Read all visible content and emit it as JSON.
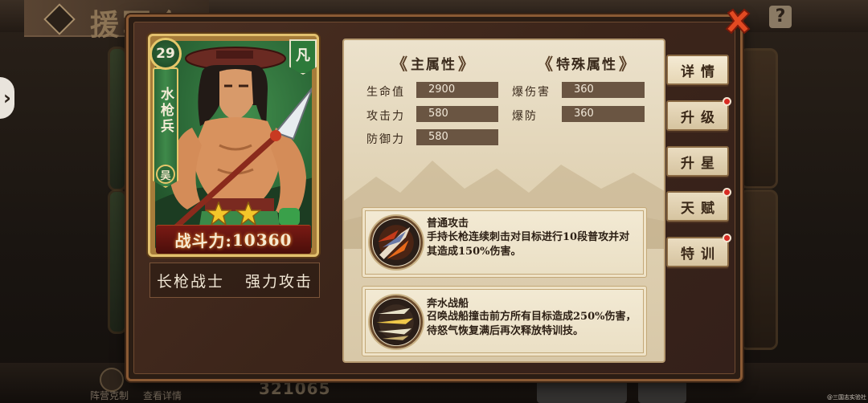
{
  "background": {
    "title": "援军介",
    "help_icon": "?",
    "bottom_left_1": "阵营克制",
    "bottom_left_2": "查看详情",
    "team_power": "321065"
  },
  "hero": {
    "level": "29",
    "name": "水枪兵",
    "rarity": "凡",
    "faction": "吴",
    "stars": 2,
    "power_label": "战斗力:",
    "power_value": "10360",
    "tags": [
      "长枪战士",
      "强力攻击"
    ]
  },
  "main_attributes": {
    "header": "主属性",
    "stats": [
      {
        "label": "生命值",
        "value": "2900"
      },
      {
        "label": "攻击力",
        "value": "580"
      },
      {
        "label": "防御力",
        "value": "580"
      }
    ]
  },
  "special_attributes": {
    "header": "特殊属性",
    "stats": [
      {
        "label": "爆伤害",
        "value": "360"
      },
      {
        "label": "爆防",
        "value": "360"
      }
    ]
  },
  "skills": [
    {
      "name": "普通攻击",
      "description": "手持长枪连续刺击对目标进行10段普攻并对其造成150%伤害。"
    },
    {
      "name": "奔水战船",
      "description": "召唤战船撞击前方所有目标造成250%伤害，待怒气恢复满后再次释放特训技。"
    }
  ],
  "tabs": [
    {
      "label": "详情",
      "active": true,
      "notify": false
    },
    {
      "label": "升级",
      "active": false,
      "notify": true
    },
    {
      "label": "升星",
      "active": false,
      "notify": false
    },
    {
      "label": "天赋",
      "active": false,
      "notify": true
    },
    {
      "label": "特训",
      "active": false,
      "notify": true
    }
  ],
  "colors": {
    "accent_red": "#d82a22",
    "panel_brown": "#3c251a",
    "parchment": "#e4d7bb",
    "hero_green": "#2d6a38"
  },
  "icons": [
    "close-icon",
    "help-icon",
    "back-arrow-icon",
    "star-icon",
    "spear-skill-icon",
    "ship-skill-icon"
  ],
  "watermark": "@三国志实验社"
}
